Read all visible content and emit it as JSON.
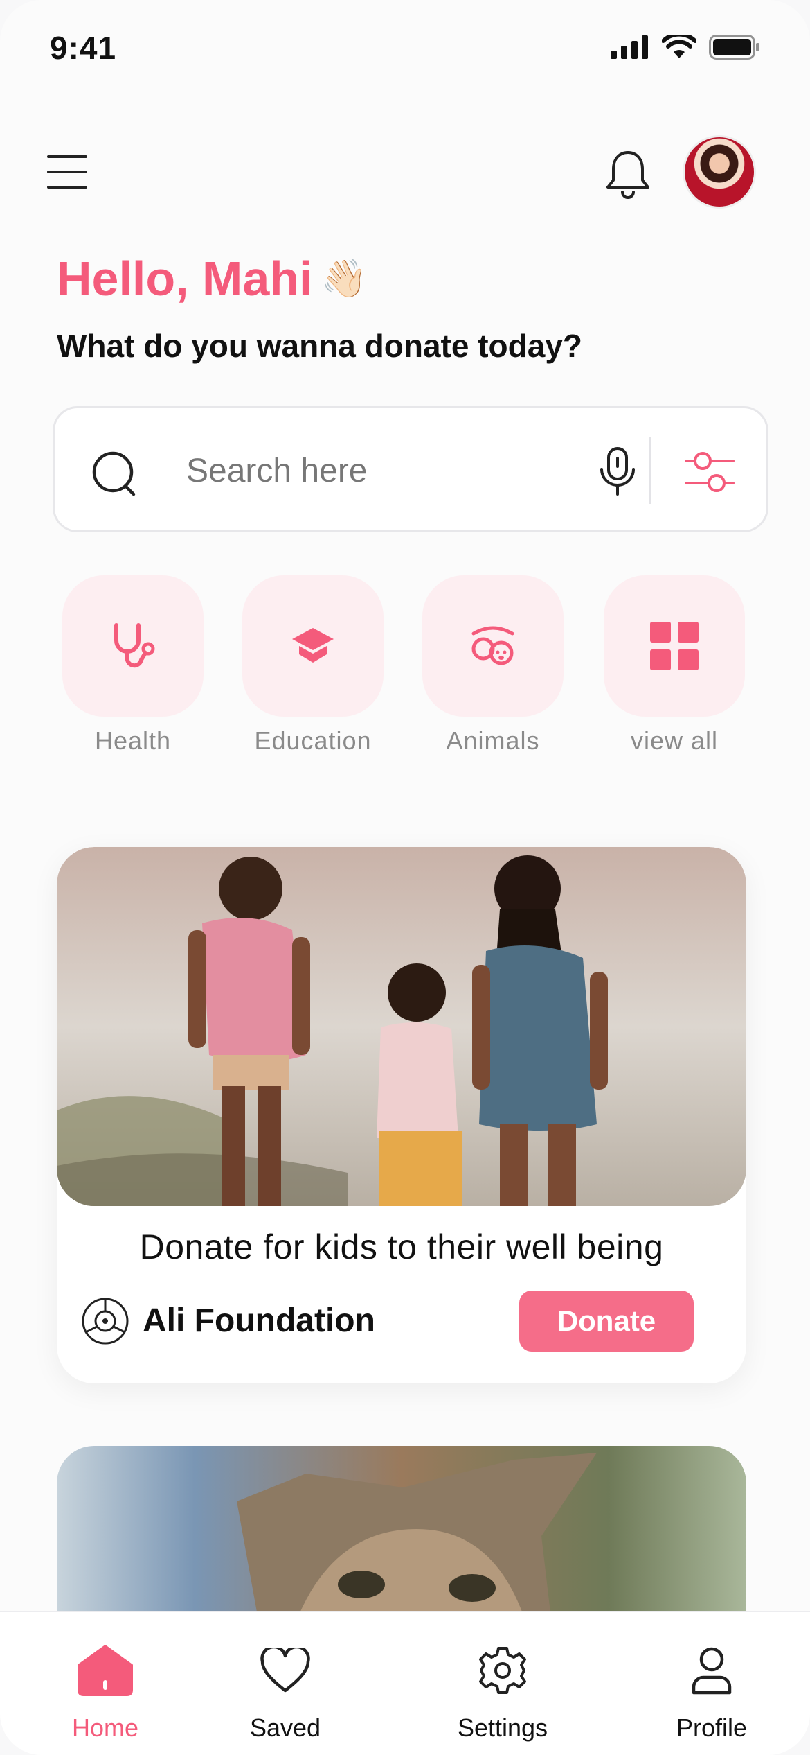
{
  "status_bar": {
    "time": "9:41"
  },
  "header": {
    "menu_icon": "hamburger-icon",
    "bell_icon": "bell-icon",
    "avatar": "user-avatar"
  },
  "greeting": {
    "hello": "Hello, Mahi",
    "wave_emoji": "👋🏻",
    "question": "What do you wanna donate today?"
  },
  "search": {
    "placeholder": "Search here",
    "search_icon": "search-icon",
    "mic_icon": "microphone-icon",
    "filter_icon": "filter-sliders-icon"
  },
  "categories": [
    {
      "label": "Health",
      "icon": "stethoscope-icon"
    },
    {
      "label": "Education",
      "icon": "graduation-cap-icon"
    },
    {
      "label": "Animals",
      "icon": "animal-paw-icon"
    },
    {
      "label": "view all",
      "icon": "grid-icon"
    }
  ],
  "cards": [
    {
      "title": "Donate for kids to their well being",
      "org": "Ali Foundation",
      "button": "Donate",
      "image": "three-kids-walking-photo"
    },
    {
      "image": "kitten-photo"
    }
  ],
  "bottom_nav": [
    {
      "label": "Home",
      "icon": "home-icon",
      "active": true
    },
    {
      "label": "Saved",
      "icon": "heart-icon"
    },
    {
      "label": "Settings",
      "icon": "gear-icon"
    },
    {
      "label": "Profile",
      "icon": "person-icon"
    }
  ],
  "colors": {
    "accent": "#f45b7b",
    "tile_bg": "#fdeef1",
    "button": "#f56d89"
  }
}
